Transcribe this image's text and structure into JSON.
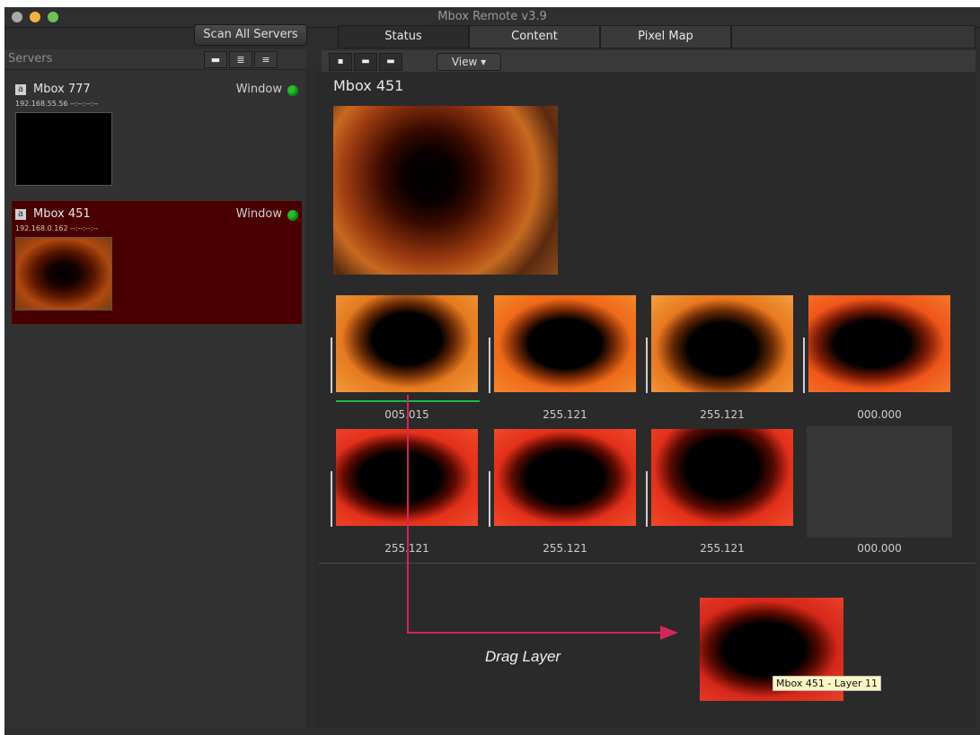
{
  "window": {
    "title": "Mbox Remote v3.9",
    "colors": {
      "accent_drag": "#d2255c",
      "selected_server": "#4a0000",
      "status_ok": "#27c12b"
    }
  },
  "sidebar": {
    "scan_button": "Scan All Servers",
    "header": "Servers",
    "view_modes": [
      "▬",
      "≣",
      "≡"
    ],
    "servers": [
      {
        "badge": "a",
        "name": "Mbox 777",
        "mode": "Window",
        "ip": "192.168.55.56   --:--:--:--",
        "status": "online",
        "selected": false
      },
      {
        "badge": "a",
        "name": "Mbox 451",
        "mode": "Window",
        "ip": "192.168.0.162   --:--:--:--",
        "status": "online",
        "selected": true
      }
    ]
  },
  "main": {
    "tabs": [
      {
        "label": "Status",
        "active": true
      },
      {
        "label": "Content",
        "active": false
      },
      {
        "label": "Pixel Map",
        "active": false
      }
    ],
    "size_buttons": [
      "▪",
      "▬",
      "▬"
    ],
    "view_button": "View ▾",
    "server_title": "Mbox 451",
    "layers": [
      {
        "label": "005.015"
      },
      {
        "label": "255.121"
      },
      {
        "label": "255.121"
      },
      {
        "label": "000.000"
      },
      {
        "label": "255.121"
      },
      {
        "label": "255.121"
      },
      {
        "label": "255.121"
      },
      {
        "label": "000.000"
      }
    ]
  },
  "drag": {
    "caption": "Drag Layer",
    "tooltip": "Mbox 451 - Layer 11"
  }
}
